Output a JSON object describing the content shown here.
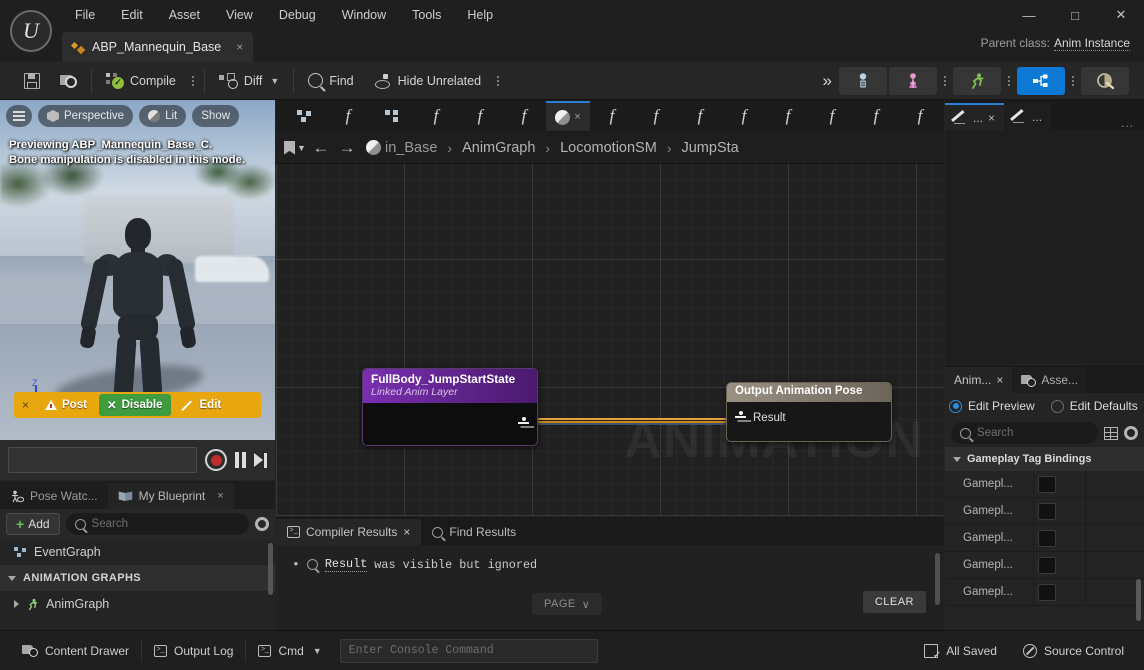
{
  "window": {
    "menu": [
      "File",
      "Edit",
      "Asset",
      "View",
      "Debug",
      "Window",
      "Tools",
      "Help"
    ],
    "document_tab": "ABP_Mannequin_Base",
    "tab_close": "×",
    "minimize": "—",
    "maximize": "□",
    "close": "✕",
    "parent_class_label": "Parent class:",
    "parent_class_value": "Anim Instance"
  },
  "toolbar": {
    "save": "",
    "browse": "",
    "compile": "Compile",
    "diff": "Diff",
    "find": "Find",
    "hide_unrelated": "Hide Unrelated",
    "overflow_chevron": "»",
    "mode_skeleton": "skeleton-icon",
    "mode_skeletal_mesh": "skeletal-mesh-icon",
    "mode_animation": "animation-run-icon",
    "mode_graph": "anim-graph-icon",
    "mode_physics": "physics-icon"
  },
  "viewport": {
    "perspective": "Perspective",
    "lit": "Lit",
    "show": "Show",
    "warning_line1": "Previewing ABP_Mannequin_Base_C.",
    "warning_line2": "Bone manipulation is disabled in this mode.",
    "axis_label": "Z",
    "notify_close": "×",
    "notify_post": "Post",
    "notify_disable": "Disable",
    "notify_edit": "Edit"
  },
  "my_blueprint": {
    "tab_pose_watch": "Pose Watc...",
    "tab_my_blueprint": "My Blueprint",
    "tab_close": "×",
    "add_label": "Add",
    "search_placeholder": "Search",
    "items": [
      {
        "label": "EventGraph",
        "type": "graph"
      },
      {
        "label": "ANIMATION GRAPHS",
        "type": "section"
      },
      {
        "label": "AnimGraph",
        "type": "anim"
      }
    ]
  },
  "graph": {
    "tabs": [
      {
        "icon": "node-icon",
        "label": ""
      },
      {
        "icon": "function-icon",
        "label": ""
      },
      {
        "icon": "node-tree-icon",
        "label": ""
      },
      {
        "icon": "function-icon",
        "label": ""
      },
      {
        "icon": "function-icon",
        "label": ""
      },
      {
        "icon": "function-icon",
        "label": ""
      },
      {
        "icon": "state-machine-icon",
        "label": "",
        "active": true,
        "close": "×"
      },
      {
        "icon": "function-icon",
        "label": ""
      },
      {
        "icon": "function-icon",
        "label": ""
      },
      {
        "icon": "function-icon",
        "label": ""
      },
      {
        "icon": "function-icon",
        "label": ""
      },
      {
        "icon": "function-icon",
        "label": ""
      },
      {
        "icon": "function-icon",
        "label": ""
      },
      {
        "icon": "function-icon",
        "label": ""
      },
      {
        "icon": "function-icon",
        "label": ""
      }
    ],
    "breadcrumbs": [
      "in_Base",
      "AnimGraph",
      "LocomotionSM",
      "JumpSta"
    ],
    "breadcrumb_separator": "›",
    "back_arrow": "←",
    "forward_arrow": "→",
    "watermark": "ANIMATION",
    "nodes": [
      {
        "title": "FullBody_JumpStartState",
        "subtitle": "Linked Anim Layer",
        "kind": "linked-anim-layer"
      },
      {
        "title": "Output Animation Pose",
        "pin": "Result",
        "kind": "output-pose"
      }
    ]
  },
  "compiler": {
    "tab_results": "Compiler Results",
    "tab_close": "×",
    "tab_find": "Find Results",
    "bullet": "•",
    "message_link": "Result",
    "message_rest": "was visible but ignored",
    "page_label": "PAGE",
    "page_chevron": "∨",
    "clear_label": "CLEAR"
  },
  "right_top": {
    "tab_active": "...",
    "tab_active_close": "×",
    "tab_other": "...",
    "overflow": "..."
  },
  "details": {
    "tab_anim": "Anim...",
    "tab_anim_close": "×",
    "tab_asset": "Asse...",
    "edit_preview": "Edit Preview",
    "edit_defaults": "Edit Defaults",
    "search_placeholder": "Search",
    "section": "Gameplay Tag Bindings",
    "rows": [
      {
        "label": "Gamepl..."
      },
      {
        "label": "Gamepl..."
      },
      {
        "label": "Gamepl..."
      },
      {
        "label": "Gamepl..."
      },
      {
        "label": "Gamepl..."
      }
    ]
  },
  "status": {
    "content_drawer": "Content Drawer",
    "output_log": "Output Log",
    "cmd": "Cmd",
    "cmd_chevron": "∨",
    "console_placeholder": "Enter Console Command",
    "all_saved": "All Saved",
    "source_control": "Source Control"
  },
  "colors": {
    "accent_blue": "#0c7ad4",
    "notify_orange": "#e8a70f",
    "disable_green": "#3e9c3e",
    "node_purple": "#7a2fb0",
    "wire_orange": "#e8a33d"
  }
}
